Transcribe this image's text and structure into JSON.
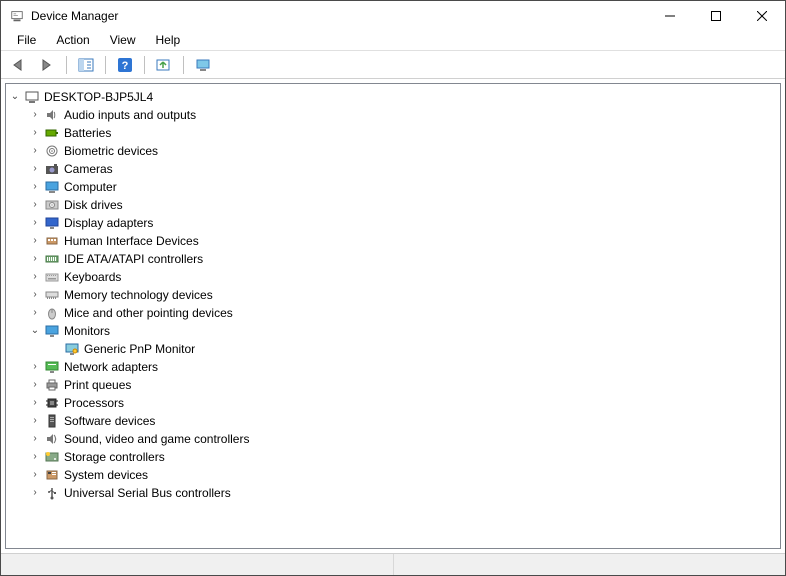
{
  "window": {
    "title": "Device Manager"
  },
  "menu": {
    "file": "File",
    "action": "Action",
    "view": "View",
    "help": "Help"
  },
  "tree": {
    "root": {
      "label": "DESKTOP-BJP5JL4",
      "expanded": true
    },
    "categories": [
      {
        "label": "Audio inputs and outputs",
        "icon": "audio",
        "expanded": false
      },
      {
        "label": "Batteries",
        "icon": "battery",
        "expanded": false
      },
      {
        "label": "Biometric devices",
        "icon": "biometric",
        "expanded": false
      },
      {
        "label": "Cameras",
        "icon": "camera",
        "expanded": false
      },
      {
        "label": "Computer",
        "icon": "computer",
        "expanded": false
      },
      {
        "label": "Disk drives",
        "icon": "disk",
        "expanded": false
      },
      {
        "label": "Display adapters",
        "icon": "display",
        "expanded": false
      },
      {
        "label": "Human Interface Devices",
        "icon": "hid",
        "expanded": false
      },
      {
        "label": "IDE ATA/ATAPI controllers",
        "icon": "ide",
        "expanded": false
      },
      {
        "label": "Keyboards",
        "icon": "keyboard",
        "expanded": false
      },
      {
        "label": "Memory technology devices",
        "icon": "memory",
        "expanded": false
      },
      {
        "label": "Mice and other pointing devices",
        "icon": "mouse",
        "expanded": false
      },
      {
        "label": "Monitors",
        "icon": "monitor",
        "expanded": true,
        "children": [
          {
            "label": "Generic PnP Monitor",
            "icon": "monitor-device"
          }
        ]
      },
      {
        "label": "Network adapters",
        "icon": "network",
        "expanded": false
      },
      {
        "label": "Print queues",
        "icon": "printer",
        "expanded": false
      },
      {
        "label": "Processors",
        "icon": "cpu",
        "expanded": false
      },
      {
        "label": "Software devices",
        "icon": "software",
        "expanded": false
      },
      {
        "label": "Sound, video and game controllers",
        "icon": "sound",
        "expanded": false
      },
      {
        "label": "Storage controllers",
        "icon": "storage",
        "expanded": false
      },
      {
        "label": "System devices",
        "icon": "system",
        "expanded": false
      },
      {
        "label": "Universal Serial Bus controllers",
        "icon": "usb",
        "expanded": false
      }
    ]
  }
}
